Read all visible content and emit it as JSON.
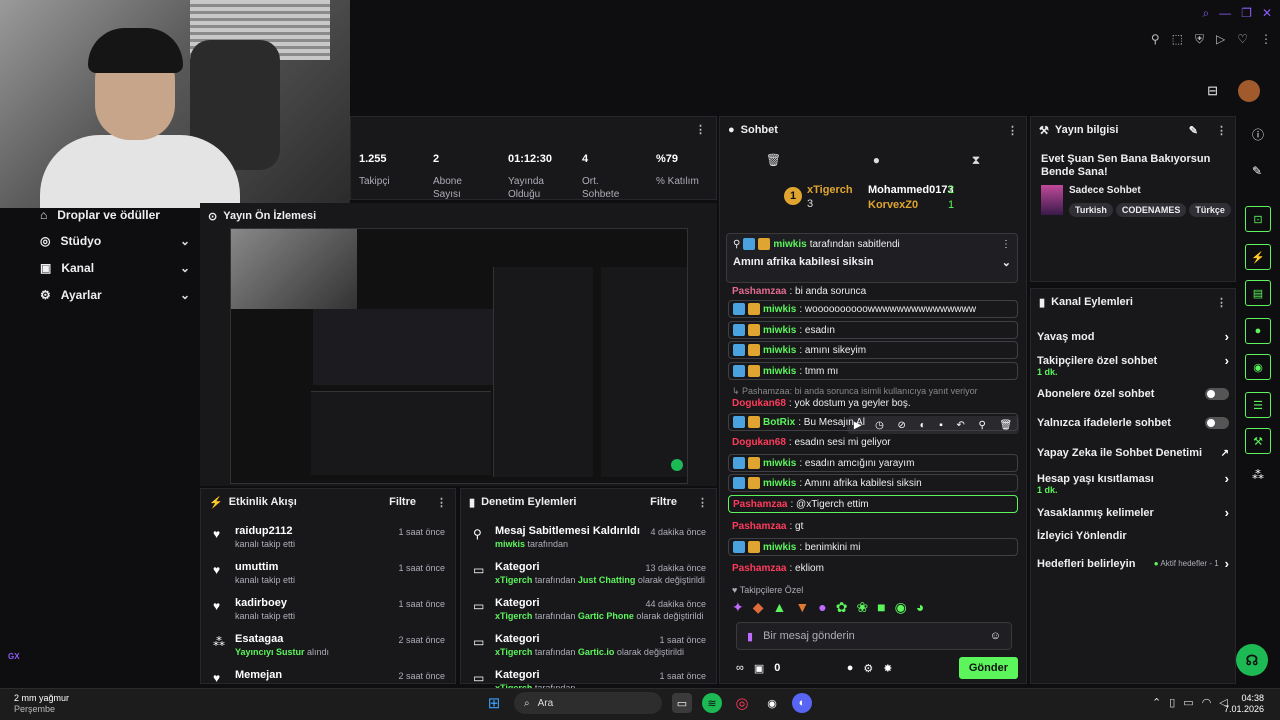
{
  "left_nav": {
    "items": [
      {
        "label": "Droplar ve ödüller",
        "icon": "gift-icon"
      },
      {
        "label": "Stüdyo",
        "icon": "studio-icon"
      },
      {
        "label": "Kanal",
        "icon": "channel-icon"
      },
      {
        "label": "Ayarlar",
        "icon": "gear-icon"
      }
    ],
    "gx_label": "GX"
  },
  "stats": [
    {
      "value": "1.255",
      "label": "Takipçi"
    },
    {
      "value": "2",
      "label": "Abone Sayısı"
    },
    {
      "value": "01:12:30",
      "label": "Yayında Olduğu"
    },
    {
      "value": "4",
      "label": "Ort. Sohbete"
    },
    {
      "value": "%79",
      "label": "% Katılım"
    }
  ],
  "preview": {
    "title": "Yayın Ön İzlemesi"
  },
  "activity": {
    "title": "Etkinlik Akışı",
    "filter": "Filtre",
    "items": [
      {
        "name": "raidup2112",
        "sub": "kanalı takip etti",
        "time": "1 saat önce"
      },
      {
        "name": "umuttim",
        "sub": "kanalı takip etti",
        "time": "1 saat önce"
      },
      {
        "name": "kadirboey",
        "sub": "kanalı takip etti",
        "time": "1 saat önce"
      },
      {
        "name": "Esatagaa",
        "sub_green": "Yayıncıyı Sustur",
        "sub_rest": " alındı",
        "time": "2 saat önce"
      },
      {
        "name": "Memejan",
        "sub": "",
        "time": "2 saat önce"
      }
    ]
  },
  "moderation": {
    "title": "Denetim Eylemleri",
    "filter": "Filtre",
    "items": [
      {
        "title": "Mesaj Sabitlemesi Kaldırıldı",
        "user": "miwkis",
        "rest": " tarafından",
        "game": "",
        "tail": "",
        "time": "4 dakika önce"
      },
      {
        "title": "Kategori",
        "user": "xTigerch",
        "rest": " tarafından ",
        "game": "Just Chatting",
        "tail": " olarak değiştirildi",
        "time": "13 dakika önce"
      },
      {
        "title": "Kategori",
        "user": "xTigerch",
        "rest": " tarafından ",
        "game": "Gartic Phone",
        "tail": " olarak değiştirildi",
        "time": "44 dakika önce"
      },
      {
        "title": "Kategori",
        "user": "xTigerch",
        "rest": " tarafından ",
        "game": "Gartic.io",
        "tail": " olarak değiştirildi",
        "time": "1 saat önce"
      },
      {
        "title": "Kategori",
        "user": "xTigerch",
        "rest": " tarafından",
        "game": "",
        "tail": "",
        "time": "1 saat önce"
      }
    ]
  },
  "chat": {
    "title": "Sohbet",
    "leaders": [
      {
        "rank": "1",
        "name": "xTigerch",
        "count": "3"
      },
      {
        "name": "Mohammed0173",
        "count": "2"
      },
      {
        "name": "KorvexZ0",
        "count": "1"
      }
    ],
    "pinned": {
      "by_user": "miwkis",
      "by_text": " tarafından sabitlendi",
      "text": "Amını afrika kabilesi siksin"
    },
    "messages": [
      {
        "user": "Pashamzaa",
        "text": ": bi anda sorunca",
        "style": "plain",
        "color": "pink",
        "badges": false
      },
      {
        "user": "miwkis",
        "text": ": woooooooooowwwwwwwwwwwwwww",
        "style": "box",
        "color": "green",
        "badges": true
      },
      {
        "user": "miwkis",
        "text": ": esadın",
        "style": "box",
        "color": "green",
        "badges": true
      },
      {
        "user": "miwkis",
        "text": ": amını sikeyim",
        "style": "box",
        "color": "green",
        "badges": true
      },
      {
        "user": "miwkis",
        "text": ": tmm mı",
        "style": "box",
        "color": "green",
        "badges": true
      },
      {
        "user": "",
        "text": "↳ Pashamzaa: bi anda sorunca isimli kullanıcıya yanıt veriyor",
        "style": "reply",
        "color": "",
        "badges": false
      },
      {
        "user": "Dogukan68",
        "text": ": yok dostum ya geyler boş.",
        "style": "plain",
        "color": "red",
        "badges": false
      },
      {
        "user": "BotRix",
        "text": ": Bu Mesajın Al",
        "style": "box",
        "color": "green",
        "badges": true
      },
      {
        "user": "Dogukan68",
        "text": ": esadın sesi mi geliyor",
        "style": "plain",
        "color": "red",
        "badges": false
      },
      {
        "user": "miwkis",
        "text": ": esadın amcığını yarayım",
        "style": "box",
        "color": "green",
        "badges": true
      },
      {
        "user": "miwkis",
        "text": ": Amını afrika kabilesi siksin",
        "style": "box",
        "color": "green",
        "badges": true
      },
      {
        "user": "Pashamzaa",
        "text": ": @xTigerch ettim",
        "style": "green",
        "color": "red",
        "badges": false
      },
      {
        "user": "Pashamzaa",
        "text": ": gt",
        "style": "plain",
        "color": "red",
        "badges": false
      },
      {
        "user": "miwkis",
        "text": ": benimkini mi",
        "style": "box",
        "color": "green",
        "badges": true
      },
      {
        "user": "Pashamzaa",
        "text": ": ekliom",
        "style": "plain",
        "color": "red",
        "badges": false
      }
    ],
    "followers_only": "Takipçilere Özel",
    "input_placeholder": "Bir mesaj gönderin",
    "points": "0",
    "send": "Gönder"
  },
  "stream_info": {
    "title": "Yayın bilgisi",
    "stream_title": "Evet Şuan Sen Bana Bakıyorsun Bende Sana!",
    "category": "Sadece Sohbet",
    "tags": [
      "Turkish",
      "CODENAMES",
      "Türkçe"
    ]
  },
  "channel_actions": {
    "title": "Kanal Eylemleri",
    "items": [
      {
        "label": "Yavaş mod",
        "sub": "",
        "ctrl": "arrow"
      },
      {
        "label": "Takipçilere özel sohbet",
        "sub": "1 dk.",
        "ctrl": "arrow"
      },
      {
        "label": "Abonelere özel sohbet",
        "sub": "",
        "ctrl": "toggle"
      },
      {
        "label": "Yalnızca ifadelerle sohbet",
        "sub": "",
        "ctrl": "toggle"
      },
      {
        "label": "Yapay Zeka ile Sohbet Denetimi",
        "sub": "",
        "ctrl": "ext"
      },
      {
        "label": "Hesap yaşı kısıtlaması",
        "sub": "1 dk.",
        "ctrl": "arrow"
      },
      {
        "label": "Yasaklanmış kelimeler",
        "sub": "",
        "ctrl": "arrow"
      },
      {
        "label": "İzleyici Yönlendir",
        "sub": "",
        "ctrl": "none"
      },
      {
        "label": "Hedefleri belirleyin",
        "sub": "",
        "ctrl": "arrow",
        "extra": "Aktif hedefler - 1"
      }
    ]
  },
  "taskbar": {
    "weather_line1": "2 mm yağmur",
    "weather_line2": "Perşembe",
    "search": "Ara",
    "time": "04:38",
    "date": "7.01.2026"
  },
  "colors": {
    "accent": "#5cf55c",
    "purple": "#8b5cf6",
    "red": "#ff3b5c",
    "bg": "#0e0e10",
    "panel": "#18181b"
  }
}
